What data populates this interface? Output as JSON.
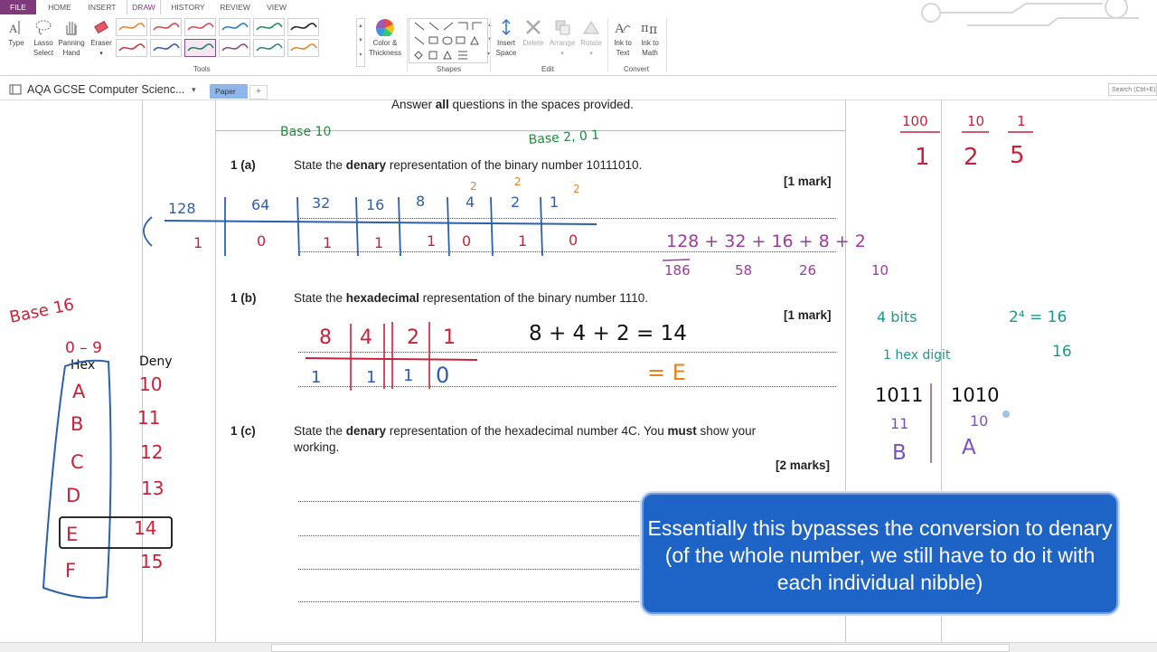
{
  "ribbon_tabs": [
    "FILE",
    "HOME",
    "INSERT",
    "DRAW",
    "HISTORY",
    "REVIEW",
    "VIEW"
  ],
  "tools": {
    "type": "Type",
    "lasso_l1": "Lasso",
    "lasso_l2": "Select",
    "pan_l1": "Panning",
    "pan_l2": "Hand",
    "eraser": "Eraser",
    "color_l1": "Color &",
    "color_l2": "Thickness",
    "group": "Tools"
  },
  "shapes_group": "Shapes",
  "edit": {
    "insert_l1": "Insert",
    "insert_l2": "Space",
    "delete": "Delete",
    "arrange": "Arrange",
    "rotate": "Rotate",
    "group": "Edit"
  },
  "convert": {
    "ink_text_l1": "Ink to",
    "ink_text_l2": "Text",
    "ink_math_l1": "Ink to",
    "ink_math_l2": "Math",
    "group": "Convert"
  },
  "notebook": {
    "title": "AQA GCSE Computer Scienc...",
    "section_tab": "Paper",
    "add_tab": "+",
    "search_placeholder": "Search (Ctrl+E)"
  },
  "pens": [
    "#e08a2e",
    "#d4474a",
    "#d84a5a",
    "#2f7fb8",
    "#2a8a5a",
    "#222222",
    "#c83a48",
    "#3a5aa8",
    "#2a7f5a",
    "#8a4f86",
    "#2e8a7a",
    "#e08a2e"
  ],
  "paper": {
    "instructions_pre": "Answer ",
    "instructions_bold": "all",
    "instructions_post": " questions in the spaces provided.",
    "q1a": {
      "num": "1 (a)",
      "pre": "State the ",
      "bold": "denary",
      "post": " representation of the binary number 10111010.",
      "marks": "[1 mark]"
    },
    "q1b": {
      "num": "1 (b)",
      "pre": "State the ",
      "bold": "hexadecimal",
      "post": " representation of the binary number 1110.",
      "marks": "[1 mark]"
    },
    "q1c": {
      "num": "1 (c)",
      "pre": "State the ",
      "bold": "denary",
      "mid": " representation of the hexadecimal number 4C.  You ",
      "bold2": "must",
      "post": " show your",
      "line2": "working.",
      "marks": "[2 marks]"
    }
  },
  "ink": {
    "base10": "Base 10",
    "base2": "Base 2, 0 1",
    "base16": "Base 16",
    "range": "0 – 9",
    "hex_header": "Hex",
    "den_header": "Deny",
    "hex_letters": [
      "A",
      "B",
      "C",
      "D",
      "E",
      "F"
    ],
    "den_values": [
      "10",
      "11",
      "12",
      "13",
      "14",
      "15"
    ],
    "place_values_a": [
      "128",
      "64",
      "32",
      "16",
      "8",
      "4",
      "2",
      "1"
    ],
    "bits_a": [
      "1",
      "0",
      "1",
      "1",
      "1",
      "0",
      "1",
      "0"
    ],
    "powers": [
      "2",
      "2",
      "2"
    ],
    "sum_a": "128 + 32 + 16 + 8 + 2",
    "partials": [
      "186",
      "58",
      "26",
      "10"
    ],
    "place_values_b": [
      "8",
      "4",
      "2",
      "1"
    ],
    "bits_b": [
      "1",
      "1",
      "1",
      "0"
    ],
    "sum_b": "8 + 4 + 2 = 14",
    "result_b": "= E",
    "fractions_top": [
      "100",
      "10",
      "1"
    ],
    "fractions_bottom": [
      "1",
      "2",
      "5"
    ],
    "four_bits": "4 bits",
    "two_pow": "2⁴ = 16",
    "one_hex": "1 hex digit",
    "sixteen": "16",
    "nibbles": [
      "1011",
      "1010"
    ],
    "nibble_values": [
      "11",
      "10"
    ],
    "nibble_hex": [
      "B",
      "A"
    ]
  },
  "caption": "Essentially this bypasses the conversion to denary (of the whole number, we still have to do it with each individual nibble)"
}
